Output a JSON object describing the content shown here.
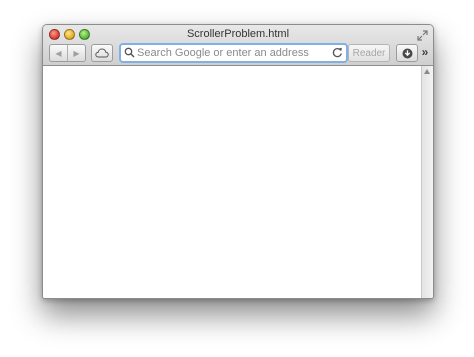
{
  "window": {
    "title": "ScrollerProblem.html"
  },
  "toolbar": {
    "back_icon": "back-arrow-icon",
    "forward_icon": "forward-arrow-icon",
    "back_glyph": "◀",
    "forward_glyph": "▶",
    "cloud_icon": "icloud-tabs-icon",
    "address_placeholder": "Search Google or enter an address",
    "reader_label": "Reader",
    "download_icon": "downloads-icon",
    "overflow_glyph": "»"
  },
  "colors": {
    "address_focus_ring": "#7fb0e6",
    "close": "#e0443a",
    "minimize": "#e9b32b",
    "zoom": "#5fbe3c"
  }
}
